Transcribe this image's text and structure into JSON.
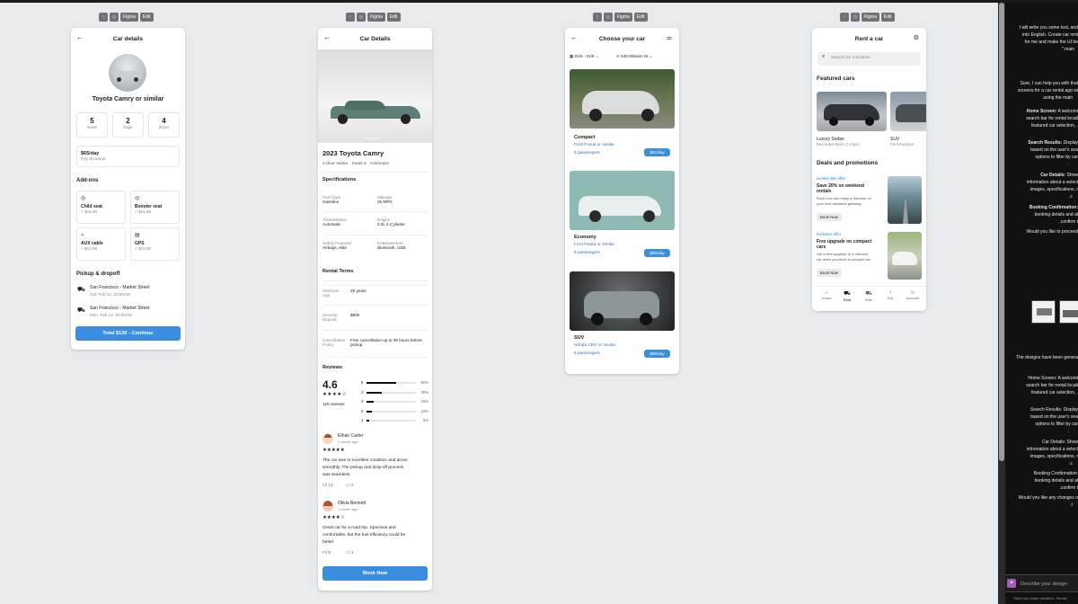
{
  "toolbar": {
    "figma": "Figma",
    "edit": "Edit"
  },
  "screen1": {
    "title": "Car details",
    "car_name": "Toyota Camry or similar",
    "stats": [
      {
        "value": "5",
        "label": "seats"
      },
      {
        "value": "2",
        "label": "bags"
      },
      {
        "value": "4",
        "label": "doors"
      }
    ],
    "price": "$65/day",
    "price_note": "Pay at pickup",
    "addons_heading": "Add-ons",
    "addons": [
      {
        "name": "Child seat",
        "price": "+ $15.99"
      },
      {
        "name": "Booster seat",
        "price": "+ $15.99"
      },
      {
        "name": "AUX cable",
        "price": "+ $15.99"
      },
      {
        "name": "GPS",
        "price": "+ $15.99"
      }
    ],
    "pickup_heading": "Pickup & dropoff",
    "pickup": [
      {
        "place": "San Francisco - Market Street",
        "time": "Sat, Feb 10, 10:00AM"
      },
      {
        "place": "San Francisco - Market Street",
        "time": "Mon, Feb 12, 10:00AM"
      }
    ],
    "cta": "Total $130 - Continue"
  },
  "screen2": {
    "title": "Car Details",
    "car_name": "2023 Toyota Camry",
    "subtitle": "4-door sedan · Seats 5 · Automatic",
    "specs_heading": "Specifications",
    "specs": [
      {
        "label": "Fuel Type",
        "value": "Gasoline"
      },
      {
        "label": "Mileage",
        "value": "25 MPG"
      },
      {
        "label": "Transmission",
        "value": "Automatic"
      },
      {
        "label": "Engine",
        "value": "2.5L 4-Cylinder"
      },
      {
        "label": "Safety Features",
        "value": "Airbags, ABS"
      },
      {
        "label": "Entertainment",
        "value": "Bluetooth, USB"
      }
    ],
    "terms_heading": "Rental Terms",
    "terms": [
      {
        "label": "Minimum Age",
        "value": "25 years"
      },
      {
        "label": "Security Deposit",
        "value": "$500"
      },
      {
        "label": "Cancellation Policy",
        "value": "Free cancellation up to 48 hours before pickup"
      }
    ],
    "reviews_heading": "Reviews",
    "rating": "4.6",
    "reviews_count": "125 reviews",
    "bars": [
      {
        "star": "5",
        "pct": "60%",
        "fill": 0.6
      },
      {
        "star": "4",
        "pct": "30%",
        "fill": 0.3
      },
      {
        "star": "3",
        "pct": "15%",
        "fill": 0.15
      },
      {
        "star": "2",
        "pct": "10%",
        "fill": 0.1
      },
      {
        "star": "1",
        "pct": "5%",
        "fill": 0.05
      }
    ],
    "reviews": [
      {
        "name": "Ethan Carter",
        "ago": "2 weeks ago",
        "text1": "The car was in excellent condition and drove",
        "text2": "smoothly. The pickup and drop-off process",
        "text3": "was seamless.",
        "likes": "12",
        "comments": "2"
      },
      {
        "name": "Olivia Bennett",
        "ago": "1 month ago",
        "text1": "Great car for a road trip. Spacious and",
        "text2": "comfortable, but the fuel efficiency could be",
        "text3": "better.",
        "likes": "8",
        "comments": "1"
      }
    ],
    "cta": "Book Now"
  },
  "screen3": {
    "title": "Choose your car",
    "date_filter": "01/6 - 01/8",
    "location_filter": "545 Mission St",
    "cars": [
      {
        "type": "Compact",
        "model": "Ford Focus or similar",
        "pax": "5 passengers",
        "price": "$51/day"
      },
      {
        "type": "Economy",
        "model": "Ford Fiesta or similar",
        "pax": "5 passengers",
        "price": "$55/day"
      },
      {
        "type": "SUV",
        "model": "Honda CRV or similar",
        "pax": "6 passengers",
        "price": "$65/day"
      }
    ]
  },
  "screen4": {
    "title": "Rent a car",
    "search_placeholder": "Search for a location",
    "featured_heading": "Featured cars",
    "featured": [
      {
        "type": "Luxury Sedan",
        "model": "Mercedes-Benz C-Class"
      },
      {
        "type": "SUV",
        "model": "Ford Explorer"
      }
    ],
    "deals_heading": "Deals and promotions",
    "deals": [
      {
        "tag": "Limited time offer",
        "title": "Save 20% on weekend rentals",
        "desc1": "Book now and enjoy a discount on",
        "desc2": "your next weekend getaway.",
        "btn": "Book Now"
      },
      {
        "tag": "Exclusive offer",
        "title": "Free upgrade on compact cars",
        "desc1": "Get a free upgrade to a mid-size",
        "desc2": "car when you book a compact car.",
        "btn": "Book Now"
      }
    ],
    "nav": [
      "Home",
      "Rent",
      "Ride",
      "Eat",
      "Account"
    ]
  },
  "chat": {
    "l1": "I will write you some text, and",
    "l2": "into English. Create car rent",
    "l3": "for me and make the UI be",
    "l4": "\".main",
    "l5": "Sure, I can help you with that",
    "l6": "screens for a car rental app wi",
    "l7": ".using the main",
    "l8": "Home Screen:",
    "l8b": "A welcomi",
    "l9": "search bar for rental locati",
    "l10": "featured car selection, .",
    "l11": "Search Results:",
    "l11b": "Display",
    "l12": "based on the user's sea",
    "l13": "options to filter by car",
    "l14": ".",
    "l15": "Car Details:",
    "l15b": "Show",
    "l16": "information about a select",
    "l17": "images, specifications, r",
    "l18": ".c",
    "l19": "Booking Confirmation:",
    "l20": "booking details and al",
    "l21": ".confirm t",
    "l22": "Would you like to proceed",
    "l23": "The designs have been genera",
    "l24": "Home Screen: A welcomi",
    "l25": "search bar for rental locati",
    "l26": "featured car selection, .",
    "l27": "Search Results: Display",
    "l28": "based on the user's sea",
    "l29": "options to filter by car",
    "l30": ".",
    "l31": "Car Details: Show",
    "l32": "information about a select",
    "l33": "images, specifications, r",
    "l34": ".c",
    "l35": "Booking Confirmation:",
    "l36": "booking details and al",
    "l37": ".confirm t",
    "l38": "Would you like any changes o",
    "l39": ".t",
    "input_placeholder": "Describe your design",
    "footer": "Stitch can make mistakes. Please"
  }
}
